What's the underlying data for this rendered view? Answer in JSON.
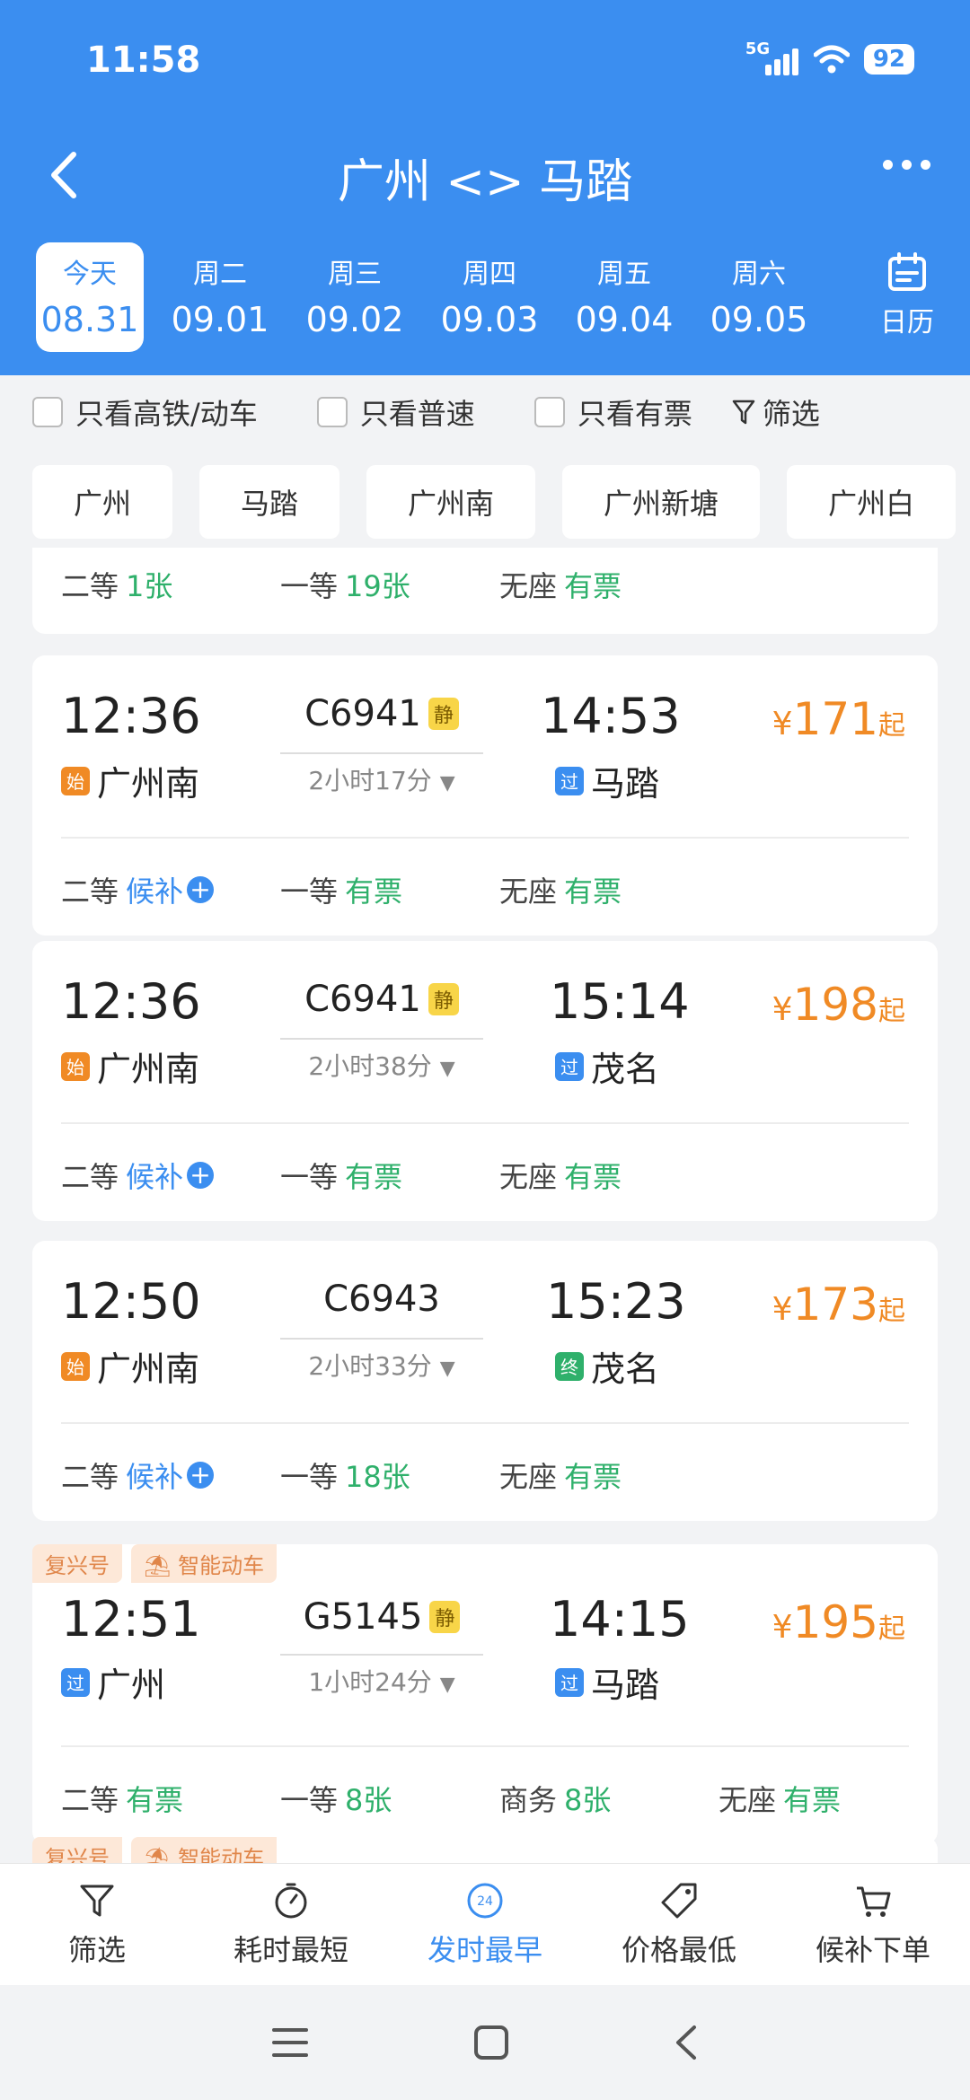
{
  "status_bar": {
    "time": "11:58",
    "network": "5G",
    "battery": "92"
  },
  "header": {
    "title": "广州 <> 马踏"
  },
  "dates": [
    {
      "dow": "今天",
      "md": "08.31",
      "active": true
    },
    {
      "dow": "周二",
      "md": "09.01"
    },
    {
      "dow": "周三",
      "md": "09.02"
    },
    {
      "dow": "周四",
      "md": "09.03"
    },
    {
      "dow": "周五",
      "md": "09.04"
    },
    {
      "dow": "周六",
      "md": "09.05"
    }
  ],
  "calendar_label": "日历",
  "filters": {
    "only_hsr": "只看高铁/动车",
    "only_normal": "只看普速",
    "only_available": "只看有票",
    "screen": "筛选"
  },
  "stations": [
    "广州",
    "马踏",
    "广州南",
    "广州新塘",
    "广州白"
  ],
  "partial_card": {
    "seats": [
      {
        "label": "二等",
        "value": "1张"
      },
      {
        "label": "一等",
        "value": "19张"
      },
      {
        "label": "无座",
        "value": "有票"
      }
    ]
  },
  "trains": [
    {
      "dep_time": "12:36",
      "dep_station": "广州南",
      "dep_tag": "始",
      "train_no": "C6941",
      "quiet": "静",
      "duration": "2小时17分",
      "arr_time": "14:53",
      "arr_station": "马踏",
      "arr_tag": "过",
      "price_symbol": "¥",
      "price": "171",
      "price_suffix": "起",
      "seats": [
        {
          "label": "二等",
          "value": "候补"
        },
        {
          "label": "一等",
          "value": "有票"
        },
        {
          "label": "无座",
          "value": "有票"
        }
      ]
    },
    {
      "dep_time": "12:36",
      "dep_station": "广州南",
      "dep_tag": "始",
      "train_no": "C6941",
      "quiet": "静",
      "duration": "2小时38分",
      "arr_time": "15:14",
      "arr_station": "茂名",
      "arr_tag": "过",
      "price_symbol": "¥",
      "price": "198",
      "price_suffix": "起",
      "seats": [
        {
          "label": "二等",
          "value": "候补"
        },
        {
          "label": "一等",
          "value": "有票"
        },
        {
          "label": "无座",
          "value": "有票"
        }
      ]
    },
    {
      "dep_time": "12:50",
      "dep_station": "广州南",
      "dep_tag": "始",
      "train_no": "C6943",
      "duration": "2小时33分",
      "arr_time": "15:23",
      "arr_station": "茂名",
      "arr_tag": "终",
      "price_symbol": "¥",
      "price": "173",
      "price_suffix": "起",
      "seats": [
        {
          "label": "二等",
          "value": "候补"
        },
        {
          "label": "一等",
          "value": "18张"
        },
        {
          "label": "无座",
          "value": "有票"
        }
      ]
    },
    {
      "badges": [
        "复兴号",
        "智能动车"
      ],
      "dep_time": "12:51",
      "dep_station": "广州",
      "dep_tag": "过",
      "train_no": "G5145",
      "quiet": "静",
      "duration": "1小时24分",
      "arr_time": "14:15",
      "arr_station": "马踏",
      "arr_tag": "过",
      "price_symbol": "¥",
      "price": "195",
      "price_suffix": "起",
      "seats": [
        {
          "label": "二等",
          "value": "有票"
        },
        {
          "label": "一等",
          "value": "8张"
        },
        {
          "label": "商务",
          "value": "8张"
        },
        {
          "label": "无座",
          "value": "有票"
        }
      ]
    }
  ],
  "peek_badges": [
    "复兴号",
    "智能动车"
  ],
  "bottom_tabs": [
    {
      "label": "筛选",
      "icon": "filter-icon"
    },
    {
      "label": "耗时最短",
      "icon": "stopwatch-icon"
    },
    {
      "label": "发时最早",
      "icon": "clock-24-icon",
      "active": true
    },
    {
      "label": "价格最低",
      "icon": "price-tag-icon"
    },
    {
      "label": "候补下单",
      "icon": "cart-icon"
    }
  ],
  "colors": {
    "primary": "#3b8ef0",
    "price": "#f08a25",
    "available": "#2fb06b",
    "quiet_badge": "#f8d548"
  }
}
